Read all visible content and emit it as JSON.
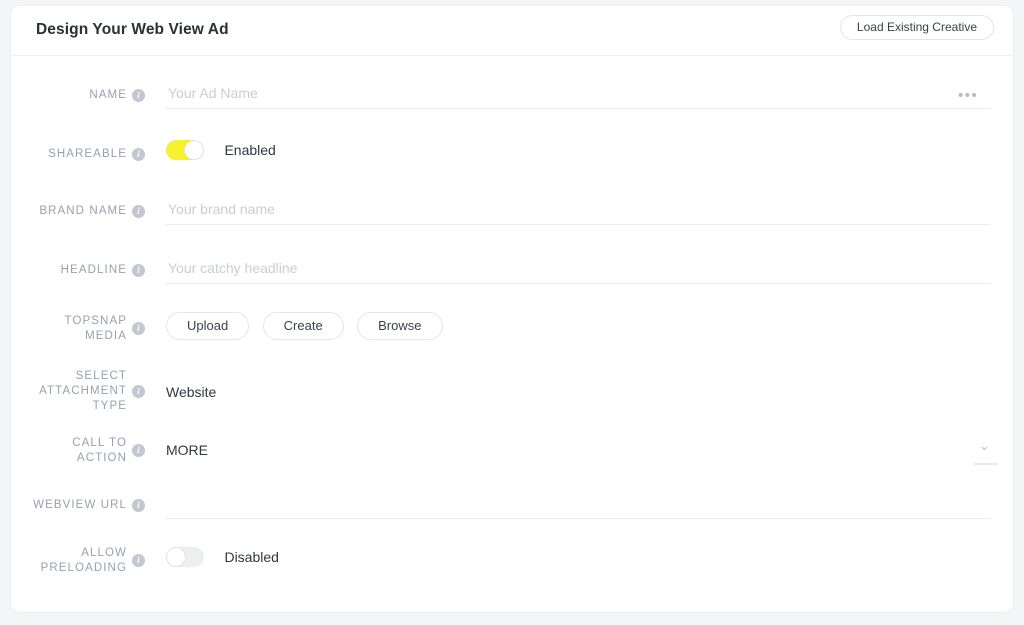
{
  "header": {
    "title": "Design Your Web View Ad",
    "load_button_label": "Load Existing Creative"
  },
  "colors": {
    "toggle_on": "#f6f02e",
    "toggle_off": "#eceef2",
    "label_text": "#9a9fae",
    "page_background": "#f4f5f7",
    "card_background": "#ffffff"
  },
  "icons": {
    "info": "i",
    "overflow_dots": "•••",
    "chevron_down": "⌄"
  },
  "form": {
    "name": {
      "label": "NAME",
      "placeholder": "Your Ad Name",
      "value": ""
    },
    "shareable": {
      "label": "SHAREABLE",
      "state_label": "Enabled",
      "enabled": true
    },
    "brand_name": {
      "label": "BRAND NAME",
      "placeholder": "Your brand name",
      "value": ""
    },
    "headline": {
      "label": "HEADLINE",
      "placeholder": "Your catchy headline",
      "value": ""
    },
    "topsnap_media": {
      "label": "TOPSNAP MEDIA",
      "buttons": [
        {
          "label": "Upload"
        },
        {
          "label": "Create"
        },
        {
          "label": "Browse"
        }
      ]
    },
    "attachment_type": {
      "label": "SELECT ATTACHMENT TYPE",
      "value": "Website"
    },
    "call_to_action": {
      "label": "CALL TO ACTION",
      "value": "MORE"
    },
    "webview_url": {
      "label": "WEBVIEW URL",
      "placeholder": "",
      "value": ""
    },
    "allow_preloading": {
      "label": "ALLOW PRELOADING",
      "state_label": "Disabled",
      "enabled": false
    }
  }
}
